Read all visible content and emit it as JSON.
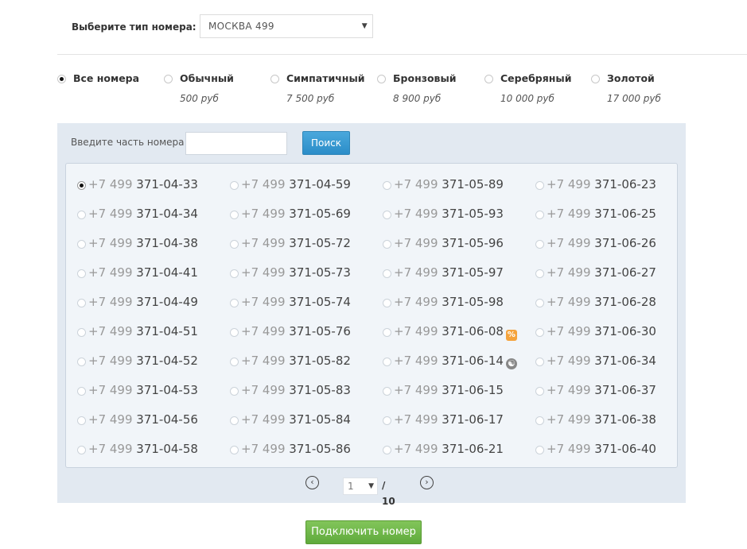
{
  "type_selector": {
    "label": "Выберите тип номера:",
    "value": "МОСКВА 499"
  },
  "categories": [
    {
      "name": "Все номера",
      "price": "",
      "checked": true
    },
    {
      "name": "Обычный",
      "price": "500 руб",
      "checked": false
    },
    {
      "name": "Симпатичный",
      "price": "7 500 руб",
      "checked": false
    },
    {
      "name": "Бронзовый",
      "price": "8 900 руб",
      "checked": false
    },
    {
      "name": "Серебряный",
      "price": "10 000 руб",
      "checked": false
    },
    {
      "name": "Золотой",
      "price": "17 000 руб",
      "checked": false
    }
  ],
  "search": {
    "label": "Введите часть номера",
    "value": "",
    "button": "Поиск"
  },
  "numbers": [
    [
      {
        "prefix": "+7 499",
        "number": "371-04-33",
        "checked": true
      },
      {
        "prefix": "+7 499",
        "number": "371-04-34"
      },
      {
        "prefix": "+7 499",
        "number": "371-04-38"
      },
      {
        "prefix": "+7 499",
        "number": "371-04-41"
      },
      {
        "prefix": "+7 499",
        "number": "371-04-49"
      },
      {
        "prefix": "+7 499",
        "number": "371-04-51"
      },
      {
        "prefix": "+7 499",
        "number": "371-04-52"
      },
      {
        "prefix": "+7 499",
        "number": "371-04-53"
      },
      {
        "prefix": "+7 499",
        "number": "371-04-56"
      },
      {
        "prefix": "+7 499",
        "number": "371-04-58"
      }
    ],
    [
      {
        "prefix": "+7 499",
        "number": "371-04-59"
      },
      {
        "prefix": "+7 499",
        "number": "371-05-69"
      },
      {
        "prefix": "+7 499",
        "number": "371-05-72"
      },
      {
        "prefix": "+7 499",
        "number": "371-05-73"
      },
      {
        "prefix": "+7 499",
        "number": "371-05-74"
      },
      {
        "prefix": "+7 499",
        "number": "371-05-76"
      },
      {
        "prefix": "+7 499",
        "number": "371-05-82"
      },
      {
        "prefix": "+7 499",
        "number": "371-05-83"
      },
      {
        "prefix": "+7 499",
        "number": "371-05-84"
      },
      {
        "prefix": "+7 499",
        "number": "371-05-86"
      }
    ],
    [
      {
        "prefix": "+7 499",
        "number": "371-05-89"
      },
      {
        "prefix": "+7 499",
        "number": "371-05-93"
      },
      {
        "prefix": "+7 499",
        "number": "371-05-96"
      },
      {
        "prefix": "+7 499",
        "number": "371-05-97"
      },
      {
        "prefix": "+7 499",
        "number": "371-05-98"
      },
      {
        "prefix": "+7 499",
        "number": "371-06-08",
        "badge": "percent-icon"
      },
      {
        "prefix": "+7 499",
        "number": "371-06-14",
        "badge": "yin-yang-icon"
      },
      {
        "prefix": "+7 499",
        "number": "371-06-15"
      },
      {
        "prefix": "+7 499",
        "number": "371-06-17"
      },
      {
        "prefix": "+7 499",
        "number": "371-06-21"
      }
    ],
    [
      {
        "prefix": "+7 499",
        "number": "371-06-23"
      },
      {
        "prefix": "+7 499",
        "number": "371-06-25"
      },
      {
        "prefix": "+7 499",
        "number": "371-06-26"
      },
      {
        "prefix": "+7 499",
        "number": "371-06-27"
      },
      {
        "prefix": "+7 499",
        "number": "371-06-28"
      },
      {
        "prefix": "+7 499",
        "number": "371-06-30"
      },
      {
        "prefix": "+7 499",
        "number": "371-06-34"
      },
      {
        "prefix": "+7 499",
        "number": "371-06-37"
      },
      {
        "prefix": "+7 499",
        "number": "371-06-38"
      },
      {
        "prefix": "+7 499",
        "number": "371-06-40"
      }
    ]
  ],
  "pagination": {
    "current": "1",
    "total": "/ 10",
    "prev_icon": "chevron-left-icon",
    "next_icon": "chevron-right-icon"
  },
  "connect_button": "Подключить номер",
  "colors": {
    "search_button": "#3a9bd4",
    "connect_button": "#6cb547",
    "panel": "#e2e9f1",
    "badge_percent": "#f5a33c"
  }
}
